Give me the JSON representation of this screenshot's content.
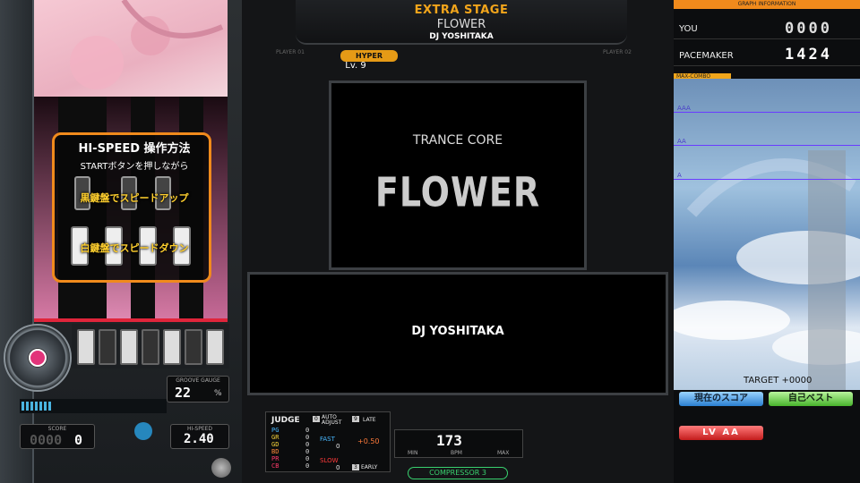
{
  "stage": {
    "label": "EXTRA STAGE",
    "title": "FLOWER",
    "artist": "DJ YOSHITAKA"
  },
  "players": {
    "p1": "PLAYER 01",
    "p2": "PLAYER 02"
  },
  "difficulty": {
    "name": "HYPER",
    "level": "Lv. 9",
    "color": "#e59a16"
  },
  "art": {
    "genre": "TRANCE CORE",
    "logo": "FLOWER",
    "artist": "DJ YOSHITAKA"
  },
  "hispeed_help": {
    "title": "HI-SPEED 操作方法",
    "sub": "STARTボタンを押しながら",
    "black_label": "黒鍵盤でスピードアップ",
    "white_label": "白鍵盤でスピードダウン"
  },
  "gauge": {
    "label": "GROOVE GAUGE",
    "value": "22",
    "unit": "%",
    "fraction": 0.22
  },
  "score": {
    "label": "SCORE",
    "value": "0000",
    "value_tail": "0"
  },
  "hispeed": {
    "label": "HI-SPEED",
    "value": "2.40"
  },
  "judge": {
    "title": "JUDGE",
    "auto_num": "0",
    "auto_label": "AUTO ADJUST",
    "late_num": "9",
    "late_label": "LATE",
    "early_num": "3",
    "early_label": "EARLY",
    "rows": [
      {
        "k": "PG",
        "v": "0",
        "color": "#49b8ff"
      },
      {
        "k": "GR",
        "v": "0",
        "color": "#f4d23a"
      },
      {
        "k": "GD",
        "v": "0",
        "color": "#f4d23a"
      },
      {
        "k": "BD",
        "v": "0",
        "color": "#ff8a3a"
      },
      {
        "k": "PR",
        "v": "0",
        "color": "#ff3a6a"
      },
      {
        "k": "CB",
        "v": "0",
        "color": "#ff3a6a"
      }
    ],
    "fast_label": "FAST",
    "fast_val": "0",
    "offset": "+0.50",
    "slow_label": "SLOW",
    "slow_val": "0"
  },
  "bpm": {
    "value": "173",
    "min": "MIN",
    "label": "BPM",
    "max": "MAX"
  },
  "compressor": "COMPRESSOR 3",
  "graph": {
    "header": "GRAPH INFORMATION",
    "you_label": "YOU",
    "you_value": "0000",
    "pm_label": "PACEMAKER",
    "pm_value": "1424",
    "max_label": "MAX-COMBO",
    "lines": [
      "AAA",
      "AA",
      "A"
    ],
    "target": "TARGET +0000",
    "btn_current": "現在のスコア",
    "btn_best": "自己ベスト",
    "btn_pm": "LV AA"
  }
}
